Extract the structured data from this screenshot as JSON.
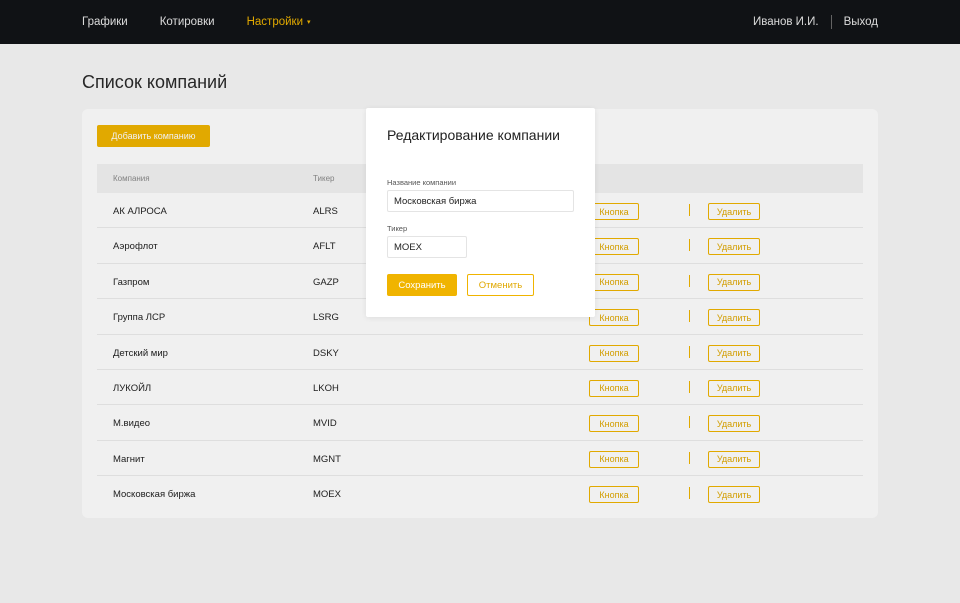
{
  "nav": {
    "items": [
      {
        "label": "Графики"
      },
      {
        "label": "Котировки"
      },
      {
        "label": "Настройки"
      }
    ],
    "caret": "▾",
    "user": "Иванов И.И.",
    "logout": "Выход"
  },
  "page": {
    "title": "Список компаний",
    "add_button": "Добавить компанию"
  },
  "table": {
    "headers": {
      "company": "Компания",
      "ticker": "Тикер"
    },
    "rows": [
      {
        "company": "АК АЛРОСА",
        "ticker": "ALRS",
        "action": "Кнопка",
        "delete": "Удалить"
      },
      {
        "company": "Аэрофлот",
        "ticker": "AFLT",
        "action": "Кнопка",
        "delete": "Удалить"
      },
      {
        "company": "Газпром",
        "ticker": "GAZP",
        "action": "Кнопка",
        "delete": "Удалить"
      },
      {
        "company": "Группа ЛСР",
        "ticker": "LSRG",
        "action": "Кнопка",
        "delete": "Удалить"
      },
      {
        "company": "Детский мир",
        "ticker": "DSKY",
        "action": "Кнопка",
        "delete": "Удалить"
      },
      {
        "company": "ЛУКОЙЛ",
        "ticker": "LKOH",
        "action": "Кнопка",
        "delete": "Удалить"
      },
      {
        "company": "М.видео",
        "ticker": "MVID",
        "action": "Кнопка",
        "delete": "Удалить"
      },
      {
        "company": "Магнит",
        "ticker": "MGNT",
        "action": "Кнопка",
        "delete": "Удалить"
      },
      {
        "company": "Московская биржа",
        "ticker": "MOEX",
        "action": "Кнопка",
        "delete": "Удалить"
      }
    ]
  },
  "modal": {
    "title": "Редактирование компании",
    "name_label": "Название компании",
    "name_value": "Московская биржа",
    "ticker_label": "Тикер",
    "ticker_value": "MOEX",
    "save": "Сохранить",
    "cancel": "Отменить"
  },
  "colors": {
    "accent": "#f0b400",
    "topbar": "#121417"
  }
}
